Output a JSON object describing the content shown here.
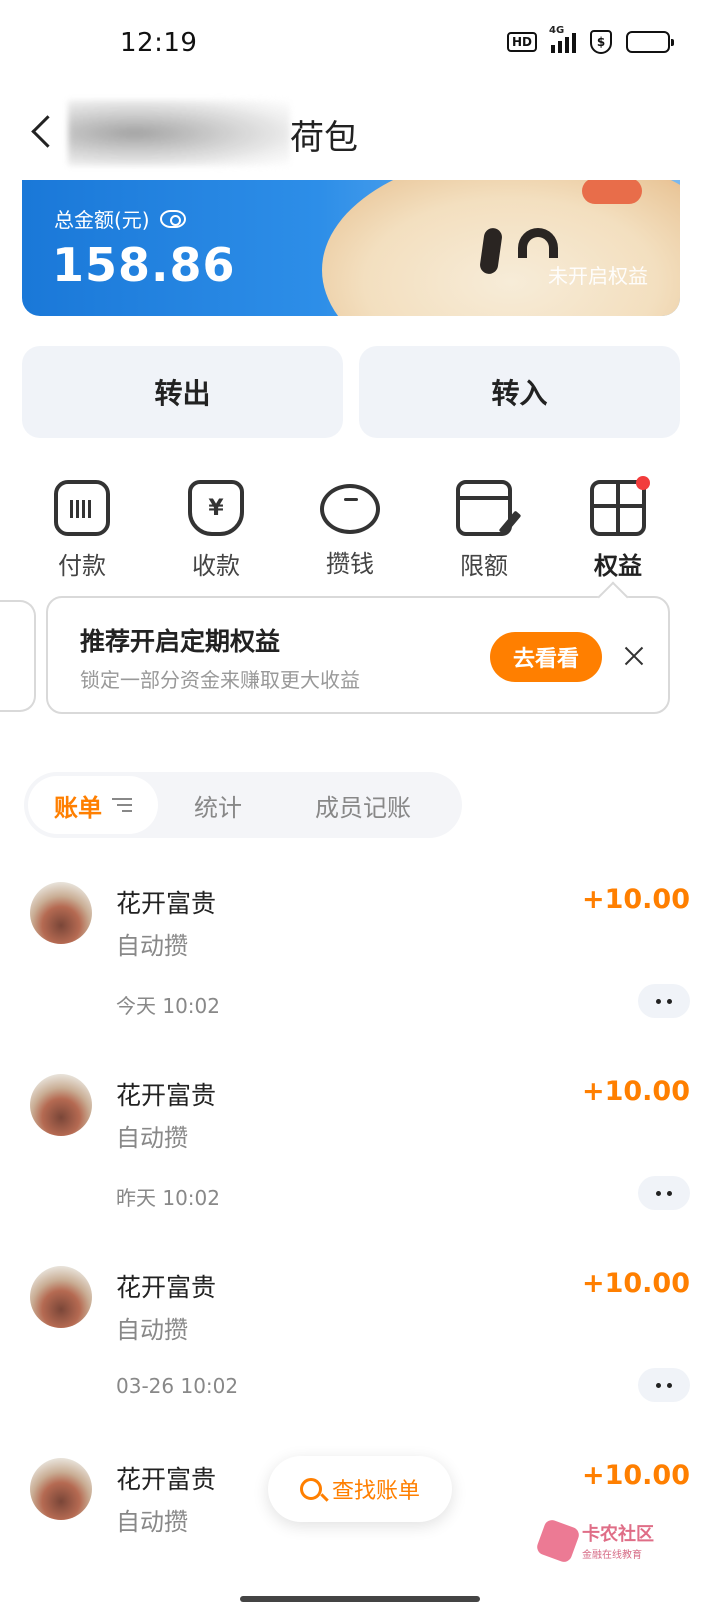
{
  "status_bar": {
    "time": "12:19",
    "network": "4G",
    "shield_glyph": "$"
  },
  "nav": {
    "title": "荷包"
  },
  "banner": {
    "label": "总金额(元)",
    "amount": "158.86",
    "status": "未开启权益"
  },
  "actions": {
    "transfer_out": "转出",
    "transfer_in": "转入"
  },
  "shortcuts": [
    {
      "label": "付款",
      "icon": "barcode-icon"
    },
    {
      "label": "收款",
      "icon": "yuan-receive-icon",
      "glyph": "¥"
    },
    {
      "label": "攒钱",
      "icon": "piggy-bank-icon"
    },
    {
      "label": "限额",
      "icon": "card-edit-icon"
    },
    {
      "label": "权益",
      "icon": "gift-icon",
      "active": true,
      "badge": "red-dot"
    }
  ],
  "tip": {
    "title": "推荐开启定期权益",
    "subtitle": "锁定一部分资金来赚取更大收益",
    "button": "去看看"
  },
  "tabs": [
    {
      "label": "账单",
      "active": true
    },
    {
      "label": "统计"
    },
    {
      "label": "成员记账"
    }
  ],
  "transactions": [
    {
      "name": "花开富贵",
      "type": "自动攒",
      "amount": "+10.00",
      "time": "今天 10:02"
    },
    {
      "name": "花开富贵",
      "type": "自动攒",
      "amount": "+10.00",
      "time": "昨天 10:02"
    },
    {
      "name": "花开富贵",
      "type": "自动攒",
      "amount": "+10.00",
      "time": "03-26 10:02"
    },
    {
      "name": "花开富贵",
      "type": "自动攒",
      "amount": "+10.00"
    }
  ],
  "search_fab": {
    "label": "查找账单"
  },
  "watermark": {
    "main": "卡农社区",
    "sub": "金融在线教育"
  },
  "colors": {
    "accent": "#ff7f00",
    "banner_blue": "#1a78d8",
    "badge_red": "#f23c3c",
    "soft_bg": "#f0f3f8"
  }
}
